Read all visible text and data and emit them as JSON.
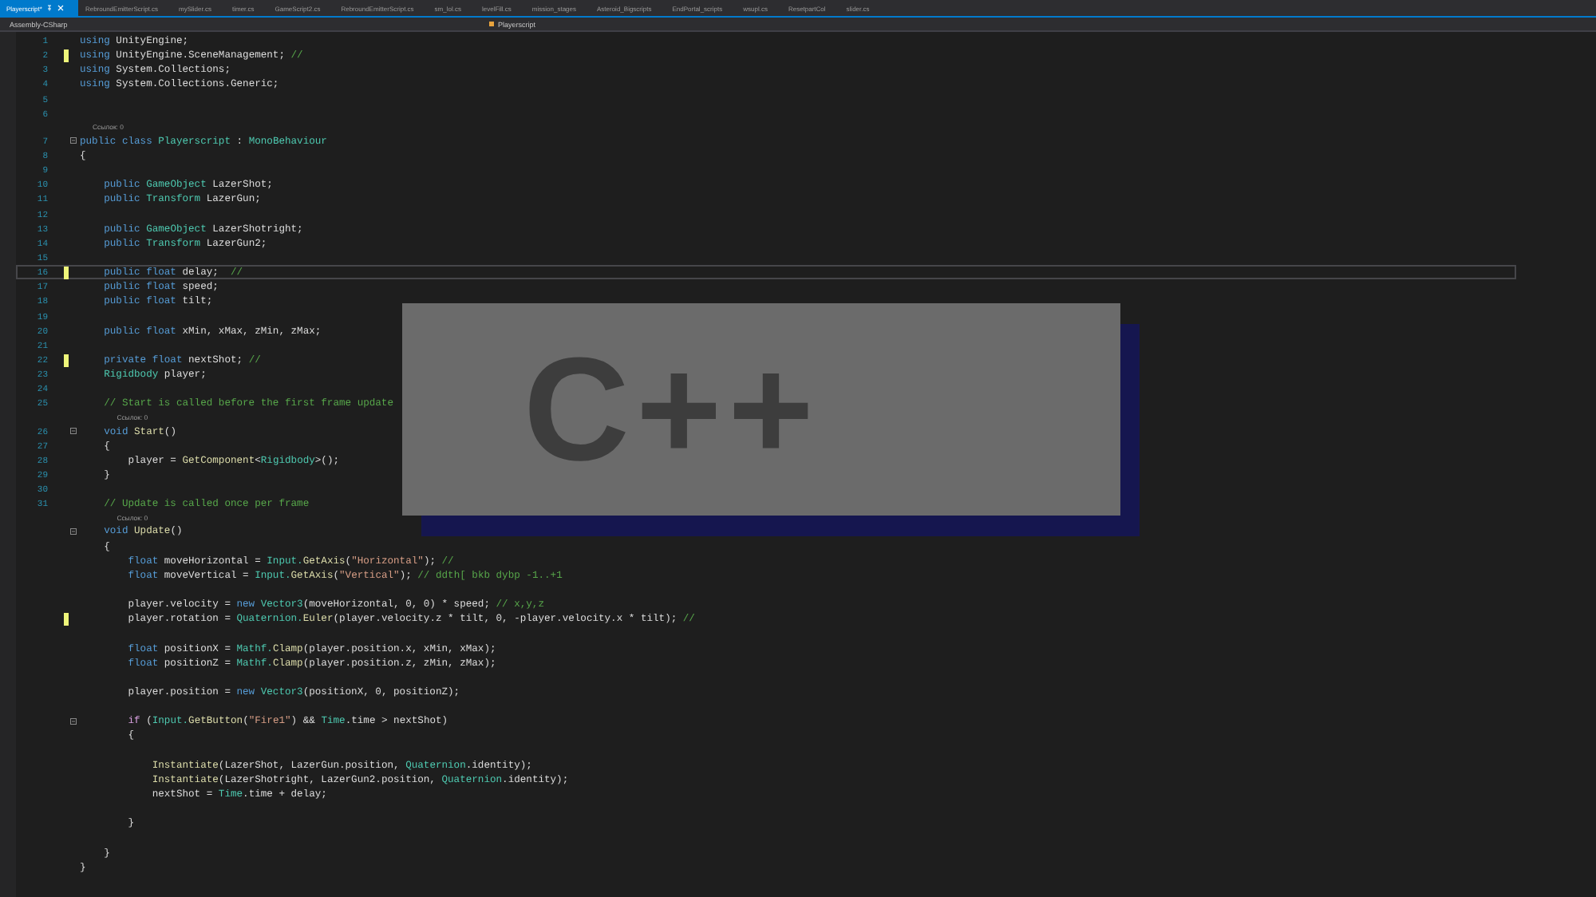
{
  "tabs": [
    {
      "label": "Playerscript*",
      "selected": true
    },
    {
      "label": "RebroundEmitterScript.cs",
      "selected": false
    },
    {
      "label": "mySlider.cs",
      "selected": false
    },
    {
      "label": "timer.cs",
      "selected": false
    },
    {
      "label": "GameScript2.cs",
      "selected": false
    },
    {
      "label": "RebroundEmitterScript.cs",
      "selected": false
    },
    {
      "label": "sm_lol.cs",
      "selected": false
    },
    {
      "label": "levelFill.cs",
      "selected": false
    },
    {
      "label": "mission_stages",
      "selected": false
    },
    {
      "label": "Asteroid_Bigscripts",
      "selected": false
    },
    {
      "label": "EndPortal_scripts",
      "selected": false
    },
    {
      "label": "wsupl.cs",
      "selected": false
    },
    {
      "label": "ResetpartCol",
      "selected": false
    },
    {
      "label": "slider.cs",
      "selected": false
    }
  ],
  "nav_bar": {
    "project": "Assembly-CSharp",
    "class": "Playerscript"
  },
  "lines": [
    {
      "number": "1",
      "tokens": [
        {
          "kind": "kw",
          "text": "using"
        },
        {
          "kind": "plain",
          "text": " UnityEngine;"
        }
      ]
    },
    {
      "number": "2",
      "changed": true,
      "tokens": [
        {
          "kind": "kw",
          "text": "using"
        },
        {
          "kind": "plain",
          "text": " UnityEngine.SceneManagement; "
        },
        {
          "kind": "comment",
          "text": "//"
        }
      ]
    },
    {
      "number": "3",
      "tokens": [
        {
          "kind": "kw",
          "text": "using"
        },
        {
          "kind": "plain",
          "text": " System.Collections;"
        }
      ]
    },
    {
      "number": "4",
      "tokens": [
        {
          "kind": "kw",
          "text": "using"
        },
        {
          "kind": "plain",
          "text": " System.Collections.Generic;"
        }
      ]
    },
    {
      "number": "5"
    },
    {
      "number": "6"
    },
    {
      "kind": "codelens",
      "text": "Ссылок: 0"
    },
    {
      "number": "7",
      "foldable": true,
      "tokens": [
        {
          "kind": "kw",
          "text": "public class "
        },
        {
          "kind": "type",
          "text": "Playerscript"
        },
        {
          "kind": "plain",
          "text": " : "
        },
        {
          "kind": "type",
          "text": "MonoBehaviour"
        }
      ]
    },
    {
      "number": "8",
      "tokens": [
        {
          "kind": "plain",
          "text": "{"
        }
      ]
    },
    {
      "number": "9"
    },
    {
      "number": "10",
      "tokens": [
        {
          "kind": "kw",
          "text": "    public "
        },
        {
          "kind": "type",
          "text": "GameObject"
        },
        {
          "kind": "plain",
          "text": " LazerShot;"
        }
      ]
    },
    {
      "number": "11",
      "tokens": [
        {
          "kind": "kw",
          "text": "    public "
        },
        {
          "kind": "type",
          "text": "Transform"
        },
        {
          "kind": "plain",
          "text": " LazerGun;"
        }
      ]
    },
    {
      "number": "12"
    },
    {
      "number": "13",
      "tokens": [
        {
          "kind": "kw",
          "text": "    public "
        },
        {
          "kind": "type",
          "text": "GameObject"
        },
        {
          "kind": "plain",
          "text": " LazerShotright;"
        }
      ]
    },
    {
      "number": "14",
      "tokens": [
        {
          "kind": "kw",
          "text": "    public "
        },
        {
          "kind": "type",
          "text": "Transform"
        },
        {
          "kind": "plain",
          "text": " LazerGun2;"
        }
      ]
    },
    {
      "number": "15"
    },
    {
      "number": "16",
      "changed": true,
      "current": true,
      "tokens": [
        {
          "kind": "kw",
          "text": "    public float"
        },
        {
          "kind": "plain",
          "text": " delay;  "
        },
        {
          "kind": "comment",
          "text": "//"
        }
      ]
    },
    {
      "number": "17",
      "tokens": [
        {
          "kind": "kw",
          "text": "    public float"
        },
        {
          "kind": "plain",
          "text": " speed;"
        }
      ]
    },
    {
      "number": "18",
      "tokens": [
        {
          "kind": "kw",
          "text": "    public float"
        },
        {
          "kind": "plain",
          "text": " tilt;"
        }
      ]
    },
    {
      "number": "19"
    },
    {
      "number": "20",
      "tokens": [
        {
          "kind": "kw",
          "text": "    public float"
        },
        {
          "kind": "plain",
          "text": " xMin, xMax, zMin, zMax;"
        }
      ]
    },
    {
      "number": "21"
    },
    {
      "number": "22",
      "changed": true,
      "tokens": [
        {
          "kind": "kw",
          "text": "    private float"
        },
        {
          "kind": "plain",
          "text": " nextShot; "
        },
        {
          "kind": "comment",
          "text": "//"
        }
      ]
    },
    {
      "number": "23",
      "tokens": [
        {
          "kind": "type",
          "text": "    Rigidbody"
        },
        {
          "kind": "plain",
          "text": " player;"
        }
      ]
    },
    {
      "number": "24"
    },
    {
      "number": "25",
      "tokens": [
        {
          "kind": "comment",
          "text": "    // Start is called before the first frame update"
        }
      ]
    },
    {
      "kind": "codelens",
      "text": "Ссылок: 0"
    },
    {
      "number": "26",
      "foldable": true,
      "tokens": [
        {
          "kind": "kw",
          "text": "    void "
        },
        {
          "kind": "method",
          "text": "Start"
        },
        {
          "kind": "plain",
          "text": "()"
        }
      ]
    },
    {
      "number": "27",
      "tokens": [
        {
          "kind": "plain",
          "text": "    {"
        }
      ]
    },
    {
      "number": "28",
      "tokens": [
        {
          "kind": "plain",
          "text": "        player = "
        },
        {
          "kind": "method",
          "text": "GetComponent"
        },
        {
          "kind": "plain",
          "text": "<"
        },
        {
          "kind": "type",
          "text": "Rigidbody"
        },
        {
          "kind": "plain",
          "text": ">();"
        }
      ]
    },
    {
      "number": "29",
      "tokens": [
        {
          "kind": "plain",
          "text": "    }"
        }
      ]
    },
    {
      "number": "30"
    },
    {
      "number": "31",
      "tokens": [
        {
          "kind": "comment",
          "text": "    // Update is called once per frame"
        }
      ]
    },
    {
      "kind": "codelens",
      "text": "Ссылок: 0"
    },
    {
      "foldable": true,
      "tokens": [
        {
          "kind": "kw",
          "text": "    void "
        },
        {
          "kind": "method",
          "text": "Update"
        },
        {
          "kind": "plain",
          "text": "()"
        }
      ]
    },
    {
      "tokens": [
        {
          "kind": "plain",
          "text": "    {"
        }
      ]
    },
    {
      "tokens": [
        {
          "kind": "kw",
          "text": "        float"
        },
        {
          "kind": "plain",
          "text": " moveHorizontal = "
        },
        {
          "kind": "type",
          "text": "Input."
        },
        {
          "kind": "method",
          "text": "GetAxis"
        },
        {
          "kind": "plain",
          "text": "("
        },
        {
          "kind": "string",
          "text": "\"Horizontal\""
        },
        {
          "kind": "plain",
          "text": "); "
        },
        {
          "kind": "comment",
          "text": "//"
        }
      ]
    },
    {
      "tokens": [
        {
          "kind": "kw",
          "text": "        float"
        },
        {
          "kind": "plain",
          "text": " moveVertical = "
        },
        {
          "kind": "type",
          "text": "Input."
        },
        {
          "kind": "method",
          "text": "GetAxis"
        },
        {
          "kind": "plain",
          "text": "("
        },
        {
          "kind": "string",
          "text": "\"Vertical\""
        },
        {
          "kind": "plain",
          "text": "); "
        },
        {
          "kind": "comment",
          "text": "// ddth[ bkb dybp -1..+1"
        }
      ]
    },
    {
      "kind": "blank"
    },
    {
      "tokens": [
        {
          "kind": "plain",
          "text": "        player.velocity = "
        },
        {
          "kind": "kw",
          "text": "new "
        },
        {
          "kind": "type",
          "text": "Vector3"
        },
        {
          "kind": "plain",
          "text": "(moveHorizontal, 0, 0) * speed; "
        },
        {
          "kind": "comment",
          "text": "// x,y,z"
        }
      ]
    },
    {
      "changed": true,
      "tokens": [
        {
          "kind": "plain",
          "text": "        player.rotation = "
        },
        {
          "kind": "type",
          "text": "Quaternion."
        },
        {
          "kind": "method",
          "text": "Euler"
        },
        {
          "kind": "plain",
          "text": "(player.velocity.z * tilt, 0, -player.velocity.x * tilt); "
        },
        {
          "kind": "comment",
          "text": "//"
        }
      ]
    },
    {
      "kind": "blank"
    },
    {
      "tokens": [
        {
          "kind": "kw",
          "text": "        float"
        },
        {
          "kind": "plain",
          "text": " positionX = "
        },
        {
          "kind": "type",
          "text": "Mathf."
        },
        {
          "kind": "method",
          "text": "Clamp"
        },
        {
          "kind": "plain",
          "text": "(player.position.x, xMin, xMax);"
        }
      ]
    },
    {
      "tokens": [
        {
          "kind": "kw",
          "text": "        float"
        },
        {
          "kind": "plain",
          "text": " positionZ = "
        },
        {
          "kind": "type",
          "text": "Mathf."
        },
        {
          "kind": "method",
          "text": "Clamp"
        },
        {
          "kind": "plain",
          "text": "(player.position.z, zMin, zMax);"
        }
      ]
    },
    {
      "kind": "blank"
    },
    {
      "tokens": [
        {
          "kind": "plain",
          "text": "        player.position = "
        },
        {
          "kind": "kw",
          "text": "new "
        },
        {
          "kind": "type",
          "text": "Vector3"
        },
        {
          "kind": "plain",
          "text": "(positionX, 0, positionZ);"
        }
      ]
    },
    {
      "kind": "blank"
    },
    {
      "foldable": true,
      "tokens": [
        {
          "kind": "ctrl",
          "text": "        if"
        },
        {
          "kind": "plain",
          "text": " ("
        },
        {
          "kind": "type",
          "text": "Input."
        },
        {
          "kind": "method",
          "text": "GetButton"
        },
        {
          "kind": "plain",
          "text": "("
        },
        {
          "kind": "string",
          "text": "\"Fire1\""
        },
        {
          "kind": "plain",
          "text": ") && "
        },
        {
          "kind": "type",
          "text": "Time"
        },
        {
          "kind": "plain",
          "text": ".time > nextShot)"
        }
      ]
    },
    {
      "tokens": [
        {
          "kind": "plain",
          "text": "        {"
        }
      ]
    },
    {
      "kind": "blank"
    },
    {
      "tokens": [
        {
          "kind": "method",
          "text": "            Instantiate"
        },
        {
          "kind": "plain",
          "text": "(LazerShot, LazerGun.position, "
        },
        {
          "kind": "type",
          "text": "Quaternion"
        },
        {
          "kind": "plain",
          "text": ".identity);"
        }
      ]
    },
    {
      "tokens": [
        {
          "kind": "method",
          "text": "            Instantiate"
        },
        {
          "kind": "plain",
          "text": "(LazerShotright, LazerGun2.position, "
        },
        {
          "kind": "type",
          "text": "Quaternion"
        },
        {
          "kind": "plain",
          "text": ".identity);"
        }
      ]
    },
    {
      "tokens": [
        {
          "kind": "plain",
          "text": "            nextShot = "
        },
        {
          "kind": "type",
          "text": "Time"
        },
        {
          "kind": "plain",
          "text": ".time + delay;"
        }
      ]
    },
    {
      "kind": "blank"
    },
    {
      "tokens": [
        {
          "kind": "plain",
          "text": "        }"
        }
      ]
    },
    {
      "kind": "blank"
    },
    {
      "tokens": [
        {
          "kind": "plain",
          "text": "    }"
        }
      ]
    },
    {
      "tokens": [
        {
          "kind": "plain",
          "text": "}"
        }
      ]
    }
  ],
  "overlay": {
    "text": "C++"
  }
}
